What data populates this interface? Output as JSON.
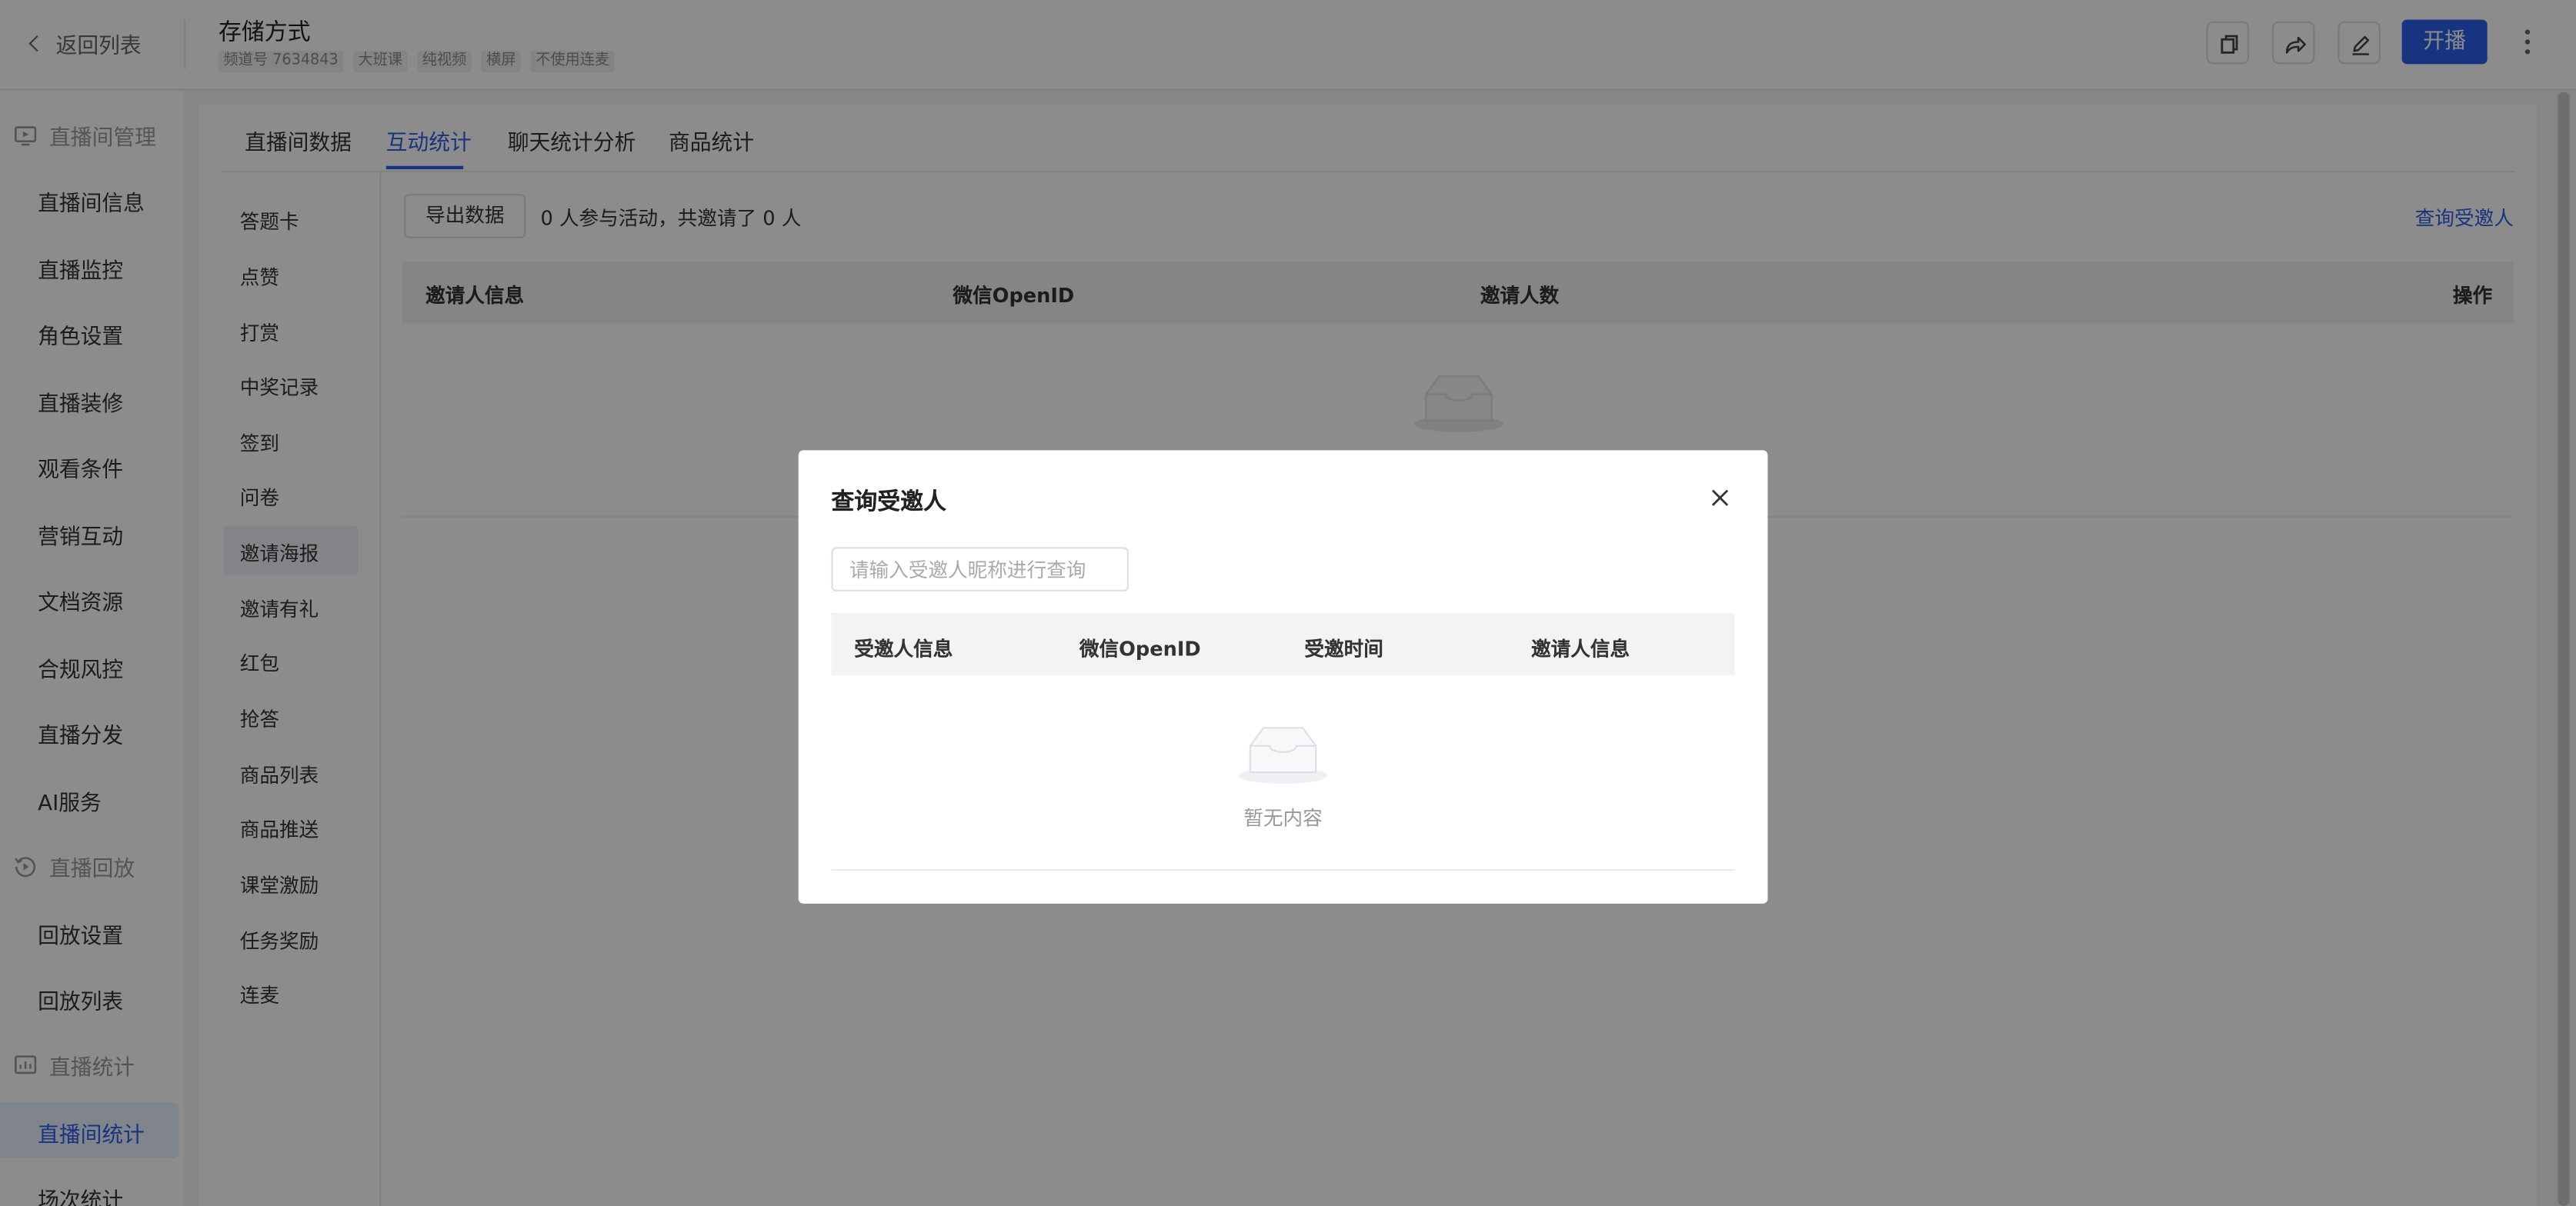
{
  "header": {
    "back_label": "返回列表",
    "title": "存储方式",
    "tags": [
      "频道号 7634843",
      "大班课",
      "纯视频",
      "横屏",
      "不使用连麦"
    ],
    "start_label": "开播"
  },
  "sidebar": {
    "groups": [
      {
        "label": "直播间管理",
        "icon": "monitor-icon"
      },
      {
        "label": "直播回放",
        "icon": "replay-icon"
      },
      {
        "label": "直播统计",
        "icon": "stats-icon"
      }
    ],
    "items": [
      "直播间信息",
      "直播监控",
      "角色设置",
      "直播装修",
      "观看条件",
      "营销互动",
      "文档资源",
      "合规风控",
      "直播分发",
      "AI服务",
      "回放设置",
      "回放列表",
      "直播间统计",
      "场次统计"
    ],
    "active_item": "直播间统计"
  },
  "tabs": [
    "直播间数据",
    "互动统计",
    "聊天统计分析",
    "商品统计"
  ],
  "active_tab": "互动统计",
  "submenu": [
    "答题卡",
    "点赞",
    "打赏",
    "中奖记录",
    "签到",
    "问卷",
    "邀请海报",
    "邀请有礼",
    "红包",
    "抢答",
    "商品列表",
    "商品推送",
    "课堂激励",
    "任务奖励",
    "连麦"
  ],
  "active_submenu": "邀请海报",
  "content": {
    "export_label": "导出数据",
    "summary": "0 人参与活动，共邀请了 0 人",
    "query_link": "查询受邀人",
    "columns": [
      "邀请人信息",
      "微信OpenID",
      "邀请人数",
      "操作"
    ]
  },
  "modal": {
    "title": "查询受邀人",
    "search_placeholder": "请输入受邀人昵称进行查询",
    "search_value": "",
    "columns": [
      "受邀人信息",
      "微信OpenID",
      "受邀时间",
      "邀请人信息"
    ],
    "empty_text": "暂无内容"
  },
  "colors": {
    "accent": "#2d5ee8",
    "overlay": "rgba(0,0,0,0.45)"
  }
}
